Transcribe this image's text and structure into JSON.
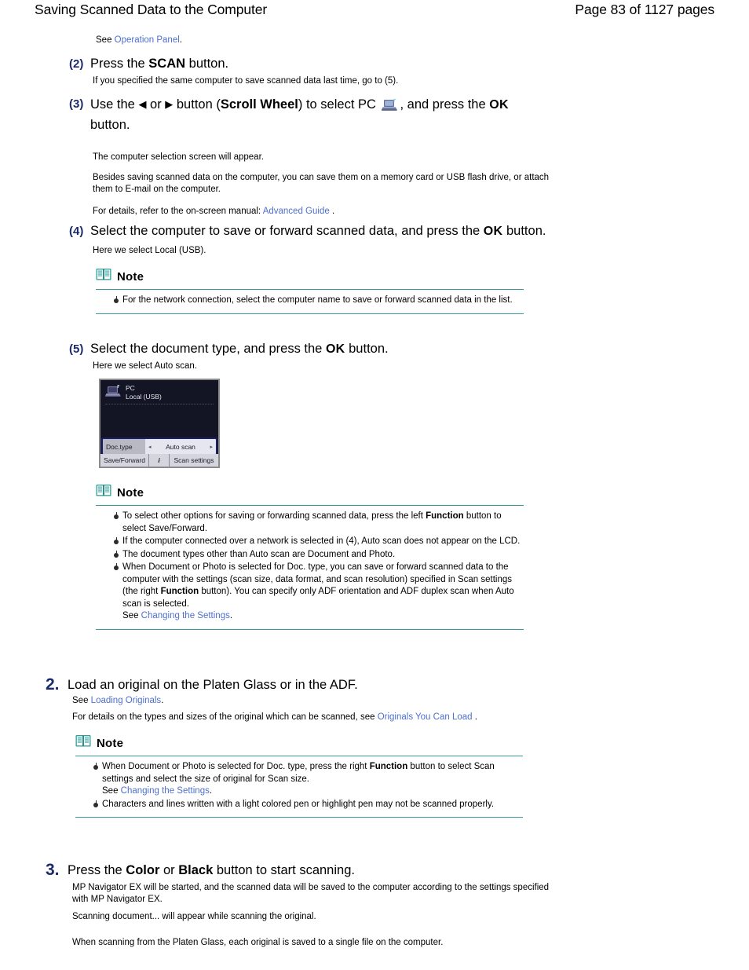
{
  "header": {
    "title": "Saving Scanned Data to the Computer",
    "page": "Page 83 of 1127 pages"
  },
  "intro": {
    "see_prefix": "See ",
    "see_link": "Operation Panel",
    "see_suffix": "."
  },
  "step2": {
    "num": "(2)",
    "text_a": "Press the ",
    "text_b": "SCAN",
    "text_c": " button.",
    "detail": "If you specified the same computer to save scanned data last time, go to (5)."
  },
  "step3": {
    "num": "(3)",
    "text_a": "Use the ",
    "arrow_left": "◀",
    "text_or": " or ",
    "arrow_right": "▶",
    "text_b": " button (",
    "scroll_wheel": "Scroll Wheel",
    "text_c": ") to select PC ",
    "text_d": ", and press the ",
    "ok": "OK",
    "text_e": "button.",
    "detail1": "The computer selection screen will appear.",
    "detail2": "Besides saving scanned data on the computer, you can save them on a memory card or USB flash drive, or attach them to E-mail on the computer.",
    "detail3_prefix": "For details, refer to the on-screen manual:  ",
    "detail3_link": "Advanced Guide",
    "detail3_suffix": " ."
  },
  "step4": {
    "num": "(4)",
    "text_a": "Select the computer to save or forward scanned data, and press the ",
    "ok": "OK",
    "text_b": " button.",
    "detail": "Here we select Local (USB).",
    "note": {
      "label": "Note",
      "items": [
        "For the network connection, select the computer name to save or forward scanned data in the list."
      ]
    }
  },
  "step5": {
    "num": "(5)",
    "text_a": "Select the document type, and press the ",
    "ok": "OK",
    "text_b": " button.",
    "detail": "Here we select Auto scan.",
    "lcd": {
      "device_label": "PC",
      "device_sub": "Local (USB)",
      "doctype_label": "Doc.type",
      "doctype_value": "Auto scan",
      "arrow_left": "◂",
      "arrow_right": "▸",
      "btn_left": "Save/Forward",
      "btn_mid": "i",
      "btn_right": "Scan settings"
    },
    "note": {
      "label": "Note",
      "items": [
        {
          "pre": "To select other options for saving or forwarding scanned data, press the left  ",
          "bold": "Function",
          "post": " button to select Save/Forward."
        },
        {
          "pre": "If the computer connected over a network is selected in (4), Auto scan does not appear on the LCD.",
          "bold": "",
          "post": ""
        },
        {
          "pre": "The document types other than Auto scan are Document and Photo.",
          "bold": "",
          "post": ""
        },
        {
          "pre": "When Document or Photo is selected for Doc. type, you can save or forward scanned data to the computer with the settings (scan size, data format, and scan resolution) specified in Scan settings (the right  ",
          "bold": "Function",
          "post": " button). You can specify only ADF orientation and ADF duplex scan when Auto scan is selected.",
          "see_prefix": "See ",
          "see_link": "Changing the Settings",
          "see_suffix": "."
        }
      ]
    }
  },
  "step_load": {
    "num": "2.",
    "title": "Load an original on the Platen Glass or in the ADF.",
    "see_prefix": "See ",
    "see_link": "Loading Originals",
    "see_suffix": ".",
    "detail_prefix": "For details on the types and sizes of the original which can be scanned, see  ",
    "detail_link": "Originals You Can Load",
    "detail_suffix": " .",
    "note": {
      "label": "Note",
      "items": [
        {
          "pre": "When Document or Photo is selected for Doc. type, press the right   ",
          "bold": "Function",
          "post": " button to select Scan settings and select the size of original for Scan size.",
          "see_prefix": "See ",
          "see_link": "Changing the Settings",
          "see_suffix": "."
        },
        {
          "pre": "Characters and lines written with a light colored pen or highlight pen may not be scanned properly.",
          "bold": "",
          "post": ""
        }
      ]
    }
  },
  "step_scan": {
    "num": "3.",
    "text_a": "Press the ",
    "bold_color": "Color",
    "text_or": " or ",
    "bold_black": "Black",
    "text_b": " button to start scanning.",
    "detail1": "MP Navigator EX will be started, and the scanned data will be saved to the computer according to the settings specified with MP Navigator EX.",
    "detail2": "Scanning document... will appear while scanning the original.",
    "detail3": "When scanning from the Platen Glass, each original is saved to a single file on the computer."
  },
  "colors": {
    "link": "#4e6fce",
    "step_num": "#1b2a6b",
    "note_rule": "#3a9a96",
    "book_icon": "#2e9e99"
  }
}
